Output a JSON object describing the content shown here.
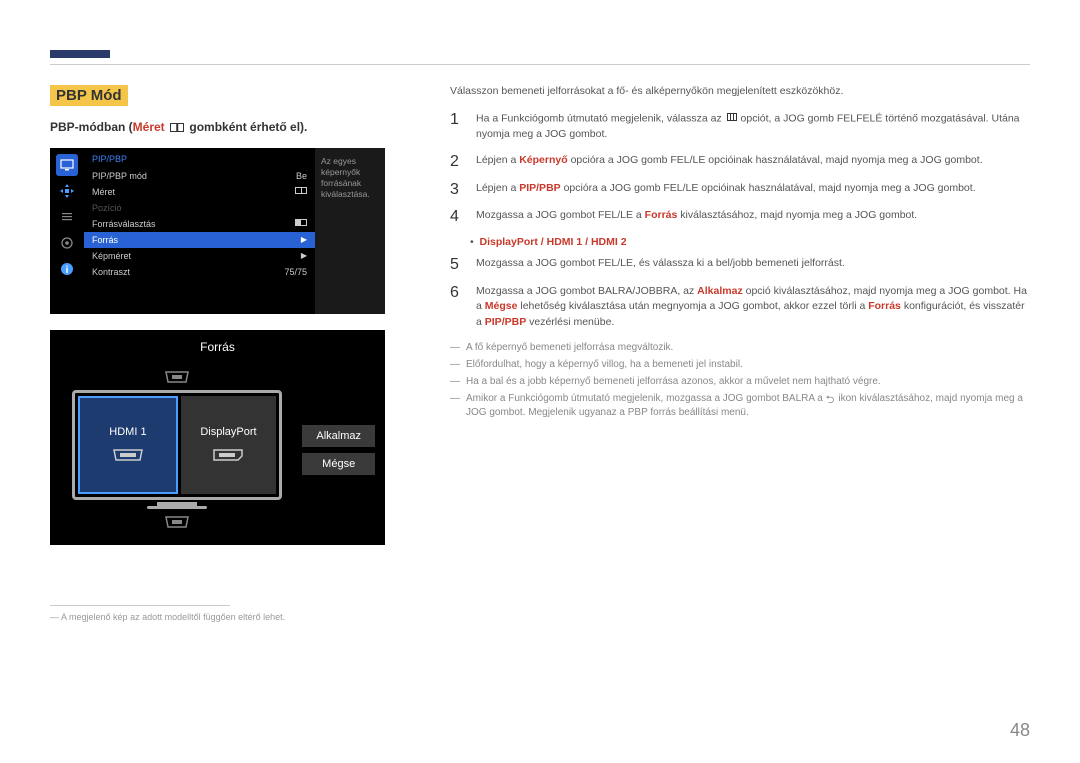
{
  "title_badge": "PBP Mód",
  "subtitle_prefix": "PBP-módban (",
  "subtitle_red": "Méret",
  "subtitle_suffix": " gombként érhető el).",
  "osd": {
    "header": "PIP/PBP",
    "rows": [
      {
        "label": "PIP/PBP mód",
        "value": "Be"
      },
      {
        "label": "Méret",
        "value": "pbp-icon"
      },
      {
        "label": "Pozíció",
        "value": ""
      },
      {
        "label": "Forrásválasztás",
        "value": "half-icon"
      },
      {
        "label": "Forrás",
        "value": "▶"
      },
      {
        "label": "Képméret",
        "value": "▶"
      },
      {
        "label": "Kontraszt",
        "value": "75/75"
      }
    ],
    "side_text": "Az egyes képernyők forrásának kiválasztása."
  },
  "forras": {
    "title": "Forrás",
    "left_label": "HDMI 1",
    "right_label": "DisplayPort",
    "btn_apply": "Alkalmaz",
    "btn_cancel": "Mégse"
  },
  "footnote": "A megjelenő kép az adott modelltől függően eltérő lehet.",
  "intro": "Válasszon bemeneti jelforrásokat a fő- és alképernyőkön megjelenített eszközökhöz.",
  "steps": {
    "s1a": "Ha a Funkciógomb útmutató megjelenik, válassza az ",
    "s1b": " opciót, a JOG gomb FELFELÉ történő mozgatásával. Utána nyomja meg a JOG gombot.",
    "s2a": "Lépjen a ",
    "s2_red": "Képernyő",
    "s2b": " opcióra a JOG gomb FEL/LE opcióinak használatával, majd nyomja meg a JOG gombot.",
    "s3a": "Lépjen a ",
    "s3_red": "PIP/PBP",
    "s3b": " opcióra a JOG gomb FEL/LE opcióinak használatával, majd nyomja meg a JOG gombot.",
    "s4a": "Mozgassa a JOG gombot FEL/LE a ",
    "s4_red": "Forrás",
    "s4b": " kiválasztásához, majd nyomja meg a JOG gombot.",
    "bullet_red": "DisplayPort / HDMI 1 / HDMI 2",
    "s5": "Mozgassa a JOG gombot FEL/LE, és válassza ki a bel/jobb bemeneti jelforrást.",
    "s6a": "Mozgassa a JOG gombot BALRA/JOBBRA, az ",
    "s6_red1": "Alkalmaz",
    "s6b": " opció kiválasztásához, majd nyomja meg a JOG gombot. Ha a ",
    "s6_red2": "Mégse",
    "s6c": " lehetőség kiválasztása után megnyomja a JOG gombot, akkor ezzel törli a ",
    "s6_red3": "Forrás",
    "s6d": " konfigurációt, és visszatér a ",
    "s6_red4": "PIP/PBP",
    "s6e": " vezérlési menübe."
  },
  "dashes": {
    "d1": "A fő képernyő bemeneti jelforrása megváltozik.",
    "d2": "Előfordulhat, hogy a képernyő villog, ha a bemeneti jel instabil.",
    "d3": "Ha a bal és a jobb képernyő bemeneti jelforrása azonos, akkor a művelet nem hajtható végre.",
    "d4a": "Amikor a Funkciógomb útmutató megjelenik, mozgassa a JOG gombot BALRA a ",
    "d4b": " ikon kiválasztásához, majd nyomja meg a JOG gombot. Megjelenik ugyanaz a PBP forrás beállítási menü."
  },
  "page_number": "48"
}
